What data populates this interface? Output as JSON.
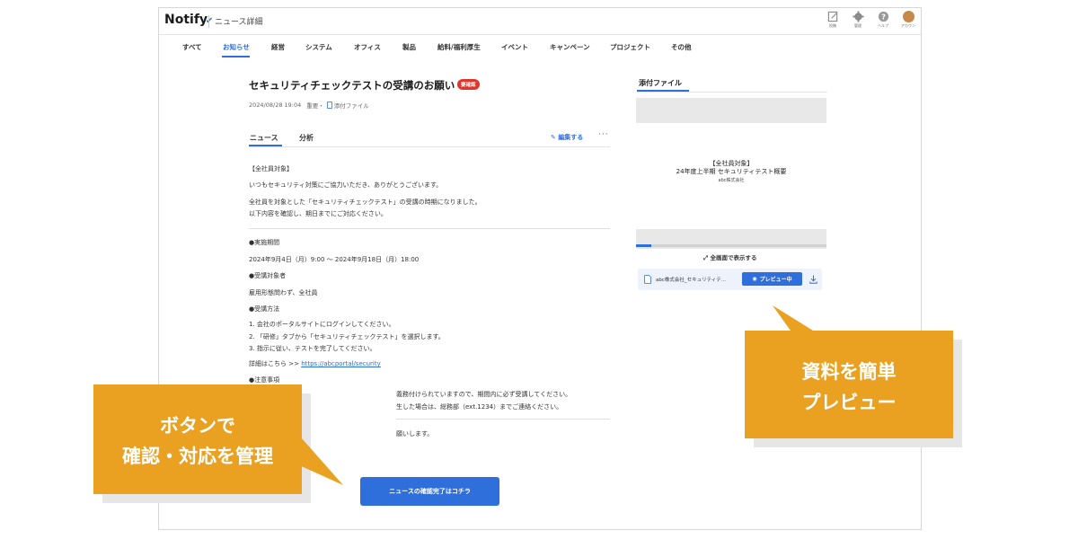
{
  "header": {
    "logo": "Notify",
    "page_title": "ニュース詳細",
    "icons": [
      {
        "name": "post-icon",
        "label": "投稿"
      },
      {
        "name": "gear-icon",
        "label": "管理"
      },
      {
        "name": "help-icon",
        "label": "ヘルプ"
      },
      {
        "name": "avatar",
        "label": "アカウン"
      }
    ]
  },
  "nav": {
    "items": [
      "すべて",
      "お知らせ",
      "経営",
      "システム",
      "オフィス",
      "製品",
      "給料/福利厚生",
      "イベント",
      "キャンペーン",
      "プロジェクト",
      "その他"
    ],
    "active": "お知らせ"
  },
  "article": {
    "title": "セキュリティチェックテストの受講のお願い",
    "badge": "要確認",
    "meta_datetime": "2024/08/28 19:04",
    "meta_importance": "重要・",
    "meta_attachment": "添付ファイル",
    "tabs": [
      "ニュース",
      "分析"
    ],
    "edit_label": "編集する",
    "more_label": "···",
    "body": {
      "target": "【全社員対象】",
      "greeting": "いつもセキュリティ対策にご協力いただき、ありがとうございます。",
      "intro1": "全社員を対象とした「セキュリティチェックテスト」の受講の時期になりました。",
      "intro2": "以下内容を確認し、期日までにご対応ください。",
      "period_heading": "●実施期間",
      "period": "2024年9月4日（月）9:00 ～ 2024年9月18日（月）18:00",
      "audience_heading": "●受講対象者",
      "audience": "雇用形態問わず、全社員",
      "method_heading": "●受講方法",
      "step1": "1. 会社のポータルサイトにログインしてください。",
      "step2": "2. 「研修」タブから「セキュリティチェックテスト」を選択します。",
      "step3": "3. 指示に従い、テストを完了してください。",
      "details_prefix": "詳細はこちら >> ",
      "details_link": "https://abcportal/security",
      "notes_heading": "●注意事項",
      "note1_partial": "義務付けられていますので、期間内に必ず受講してください。",
      "note2_partial": "生した場合は、総務部（ext.1234）までご連絡ください。",
      "closing_partial": "願いします。"
    },
    "confirm_button": "ニュースの確認完了はコチラ"
  },
  "attachments": {
    "title": "添付ファイル",
    "preview": {
      "line1": "【全社員対象】",
      "line2": "24年度上半期 セキュリティテスト概要",
      "line3": "abc株式会社"
    },
    "preview_progress": 0.08,
    "fullscreen_label": "全画面で表示する",
    "file_name": "abc株式会社_セキュリティテ...",
    "preview_button": "プレビュー中"
  },
  "callouts": {
    "left": {
      "line1": "ボタンで",
      "line2": "確認・対応を管理"
    },
    "right": {
      "line1": "資料を簡単",
      "line2": "プレビュー"
    }
  },
  "colors": {
    "accent": "#2f6fdc",
    "badge": "#e0352b",
    "callout": "#eaa122"
  }
}
